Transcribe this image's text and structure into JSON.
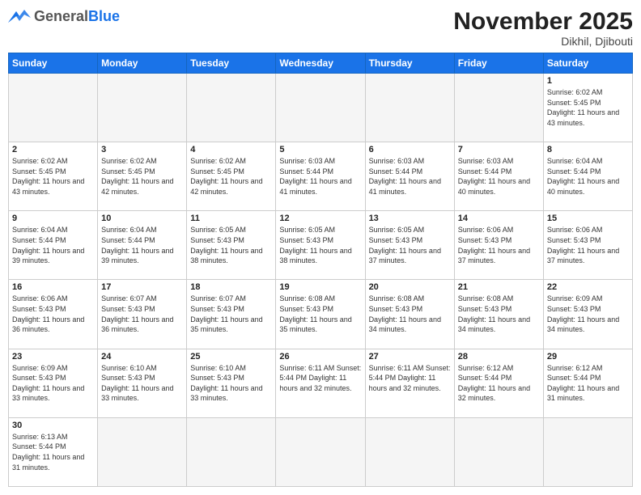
{
  "header": {
    "logo_general": "General",
    "logo_blue": "Blue",
    "month_title": "November 2025",
    "location": "Dikhil, Djibouti"
  },
  "weekdays": [
    "Sunday",
    "Monday",
    "Tuesday",
    "Wednesday",
    "Thursday",
    "Friday",
    "Saturday"
  ],
  "weeks": [
    [
      {
        "day": "",
        "info": ""
      },
      {
        "day": "",
        "info": ""
      },
      {
        "day": "",
        "info": ""
      },
      {
        "day": "",
        "info": ""
      },
      {
        "day": "",
        "info": ""
      },
      {
        "day": "",
        "info": ""
      },
      {
        "day": "1",
        "info": "Sunrise: 6:02 AM\nSunset: 5:45 PM\nDaylight: 11 hours\nand 43 minutes."
      }
    ],
    [
      {
        "day": "2",
        "info": "Sunrise: 6:02 AM\nSunset: 5:45 PM\nDaylight: 11 hours\nand 43 minutes."
      },
      {
        "day": "3",
        "info": "Sunrise: 6:02 AM\nSunset: 5:45 PM\nDaylight: 11 hours\nand 42 minutes."
      },
      {
        "day": "4",
        "info": "Sunrise: 6:02 AM\nSunset: 5:45 PM\nDaylight: 11 hours\nand 42 minutes."
      },
      {
        "day": "5",
        "info": "Sunrise: 6:03 AM\nSunset: 5:44 PM\nDaylight: 11 hours\nand 41 minutes."
      },
      {
        "day": "6",
        "info": "Sunrise: 6:03 AM\nSunset: 5:44 PM\nDaylight: 11 hours\nand 41 minutes."
      },
      {
        "day": "7",
        "info": "Sunrise: 6:03 AM\nSunset: 5:44 PM\nDaylight: 11 hours\nand 40 minutes."
      },
      {
        "day": "8",
        "info": "Sunrise: 6:04 AM\nSunset: 5:44 PM\nDaylight: 11 hours\nand 40 minutes."
      }
    ],
    [
      {
        "day": "9",
        "info": "Sunrise: 6:04 AM\nSunset: 5:44 PM\nDaylight: 11 hours\nand 39 minutes."
      },
      {
        "day": "10",
        "info": "Sunrise: 6:04 AM\nSunset: 5:44 PM\nDaylight: 11 hours\nand 39 minutes."
      },
      {
        "day": "11",
        "info": "Sunrise: 6:05 AM\nSunset: 5:43 PM\nDaylight: 11 hours\nand 38 minutes."
      },
      {
        "day": "12",
        "info": "Sunrise: 6:05 AM\nSunset: 5:43 PM\nDaylight: 11 hours\nand 38 minutes."
      },
      {
        "day": "13",
        "info": "Sunrise: 6:05 AM\nSunset: 5:43 PM\nDaylight: 11 hours\nand 37 minutes."
      },
      {
        "day": "14",
        "info": "Sunrise: 6:06 AM\nSunset: 5:43 PM\nDaylight: 11 hours\nand 37 minutes."
      },
      {
        "day": "15",
        "info": "Sunrise: 6:06 AM\nSunset: 5:43 PM\nDaylight: 11 hours\nand 37 minutes."
      }
    ],
    [
      {
        "day": "16",
        "info": "Sunrise: 6:06 AM\nSunset: 5:43 PM\nDaylight: 11 hours\nand 36 minutes."
      },
      {
        "day": "17",
        "info": "Sunrise: 6:07 AM\nSunset: 5:43 PM\nDaylight: 11 hours\nand 36 minutes."
      },
      {
        "day": "18",
        "info": "Sunrise: 6:07 AM\nSunset: 5:43 PM\nDaylight: 11 hours\nand 35 minutes."
      },
      {
        "day": "19",
        "info": "Sunrise: 6:08 AM\nSunset: 5:43 PM\nDaylight: 11 hours\nand 35 minutes."
      },
      {
        "day": "20",
        "info": "Sunrise: 6:08 AM\nSunset: 5:43 PM\nDaylight: 11 hours\nand 34 minutes."
      },
      {
        "day": "21",
        "info": "Sunrise: 6:08 AM\nSunset: 5:43 PM\nDaylight: 11 hours\nand 34 minutes."
      },
      {
        "day": "22",
        "info": "Sunrise: 6:09 AM\nSunset: 5:43 PM\nDaylight: 11 hours\nand 34 minutes."
      }
    ],
    [
      {
        "day": "23",
        "info": "Sunrise: 6:09 AM\nSunset: 5:43 PM\nDaylight: 11 hours\nand 33 minutes."
      },
      {
        "day": "24",
        "info": "Sunrise: 6:10 AM\nSunset: 5:43 PM\nDaylight: 11 hours\nand 33 minutes."
      },
      {
        "day": "25",
        "info": "Sunrise: 6:10 AM\nSunset: 5:43 PM\nDaylight: 11 hours\nand 33 minutes."
      },
      {
        "day": "26",
        "info": "Sunrise: 6:11 AM\nSunset: 5:44 PM\nDaylight: 11 hours\nand 32 minutes."
      },
      {
        "day": "27",
        "info": "Sunrise: 6:11 AM\nSunset: 5:44 PM\nDaylight: 11 hours\nand 32 minutes."
      },
      {
        "day": "28",
        "info": "Sunrise: 6:12 AM\nSunset: 5:44 PM\nDaylight: 11 hours\nand 32 minutes."
      },
      {
        "day": "29",
        "info": "Sunrise: 6:12 AM\nSunset: 5:44 PM\nDaylight: 11 hours\nand 31 minutes."
      }
    ],
    [
      {
        "day": "30",
        "info": "Sunrise: 6:13 AM\nSunset: 5:44 PM\nDaylight: 11 hours\nand 31 minutes."
      },
      {
        "day": "",
        "info": ""
      },
      {
        "day": "",
        "info": ""
      },
      {
        "day": "",
        "info": ""
      },
      {
        "day": "",
        "info": ""
      },
      {
        "day": "",
        "info": ""
      },
      {
        "day": "",
        "info": ""
      }
    ]
  ]
}
